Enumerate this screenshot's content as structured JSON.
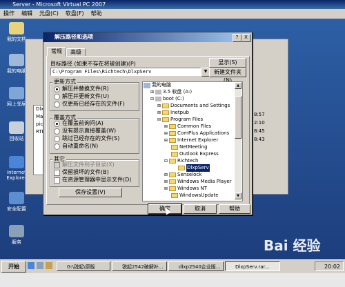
{
  "vpc": {
    "title": "Server - Microsoft Virtual PC 2007",
    "menu": [
      "操作",
      "编辑",
      "光盘(C)",
      "软盘(F)",
      "帮助"
    ]
  },
  "desktop_icons": [
    {
      "label": "我的文档"
    },
    {
      "label": "我的电脑"
    },
    {
      "label": "网上邻居"
    },
    {
      "label": "回收站"
    },
    {
      "label": "Internet Explorer"
    },
    {
      "label": "安全配置"
    },
    {
      "label": "服务"
    }
  ],
  "bg_list": [
    "Dlxp",
    "Manu",
    "pic",
    "RTI"
  ],
  "bg_times": [
    "8:57",
    "2:10",
    "8:45",
    "8:43"
  ],
  "dialog": {
    "title": "解压路径和选项",
    "help_btn": "?",
    "close_btn": "X",
    "tabs": [
      "常规",
      "高级"
    ],
    "target_label": "目标路径 (如果不存在将被创建)(P)",
    "target_path": "C:\\Program Files\\Richtech\\DlxpServ",
    "show_btn": "显示(S)",
    "new_folder_btn": "新建文件夹(N)",
    "update": {
      "title": "更新方式",
      "options": [
        "解压并替换文件(R)",
        "解压并更新文件(U)",
        "仅更新已经存在的文件(F)"
      ],
      "selected": 0
    },
    "overwrite": {
      "title": "覆盖方式",
      "options": [
        "在覆盖前询问(A)",
        "没有提示直接覆盖(W)",
        "跳过已经存在的文件(S)",
        "自动重命名(N)"
      ],
      "selected": 0
    },
    "misc": {
      "title": "其它",
      "options": [
        "解压文件到子目录(X)",
        "保留损坏的文件(B)",
        "在资源管理器中显示文件(D)"
      ]
    },
    "save_btn": "保存设置(V)",
    "ok": "确定",
    "cancel": "取消",
    "help": "帮助"
  },
  "tree": [
    {
      "label": "我的电脑",
      "level": 0
    },
    {
      "label": "3.5 软盘 (A:)",
      "level": 1
    },
    {
      "label": "boot (C:)",
      "level": 1
    },
    {
      "label": "Documents and Settings",
      "level": 2
    },
    {
      "label": "Inetpub",
      "level": 2
    },
    {
      "label": "Program Files",
      "level": 2
    },
    {
      "label": "Common Files",
      "level": 3
    },
    {
      "label": "ComPlus Applications",
      "level": 3
    },
    {
      "label": "Internet Explorer",
      "level": 3
    },
    {
      "label": "NetMeeting",
      "level": 3
    },
    {
      "label": "Outlook Express",
      "level": 3
    },
    {
      "label": "Richtech",
      "level": 3
    },
    {
      "label": "DlxpServ",
      "level": 4,
      "selected": true
    },
    {
      "label": "Senselock",
      "level": 3
    },
    {
      "label": "Windows Media Player",
      "level": 3
    },
    {
      "label": "Windows NT",
      "level": 3
    },
    {
      "label": "WindowsUpdate",
      "level": 3
    }
  ],
  "taskbar": {
    "start": "开始",
    "items": [
      "G:\\锐起\\原版",
      "锐起2542破解补...",
      "dlxp2540企业版...",
      "DlxpServ.rar..."
    ],
    "clock": "20:02"
  },
  "watermark": "Bai 经验"
}
